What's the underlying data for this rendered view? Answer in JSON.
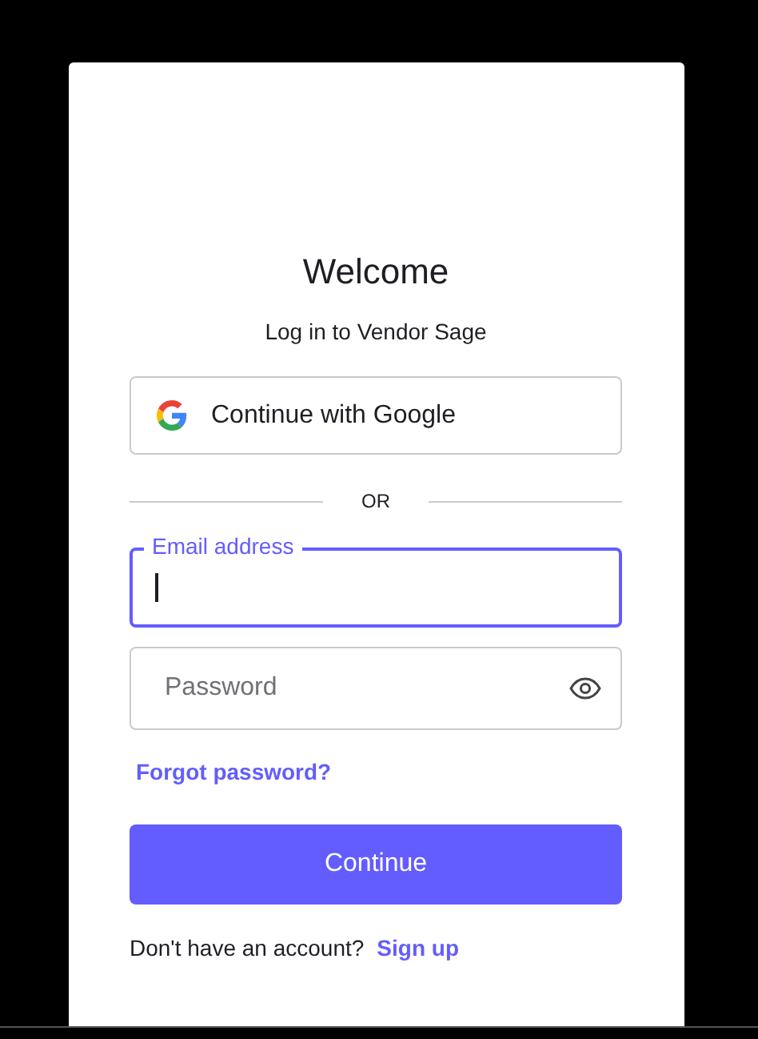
{
  "title": "Welcome",
  "subtitle": "Log in to Vendor Sage",
  "social_button": {
    "label": "Continue with Google"
  },
  "divider": "OR",
  "email": {
    "label": "Email address",
    "focused": true
  },
  "password": {
    "placeholder": "Password"
  },
  "forgot_link": "Forgot password?",
  "submit_button": "Continue",
  "signup_prompt": "Don't have an account?",
  "signup_link": "Sign up"
}
